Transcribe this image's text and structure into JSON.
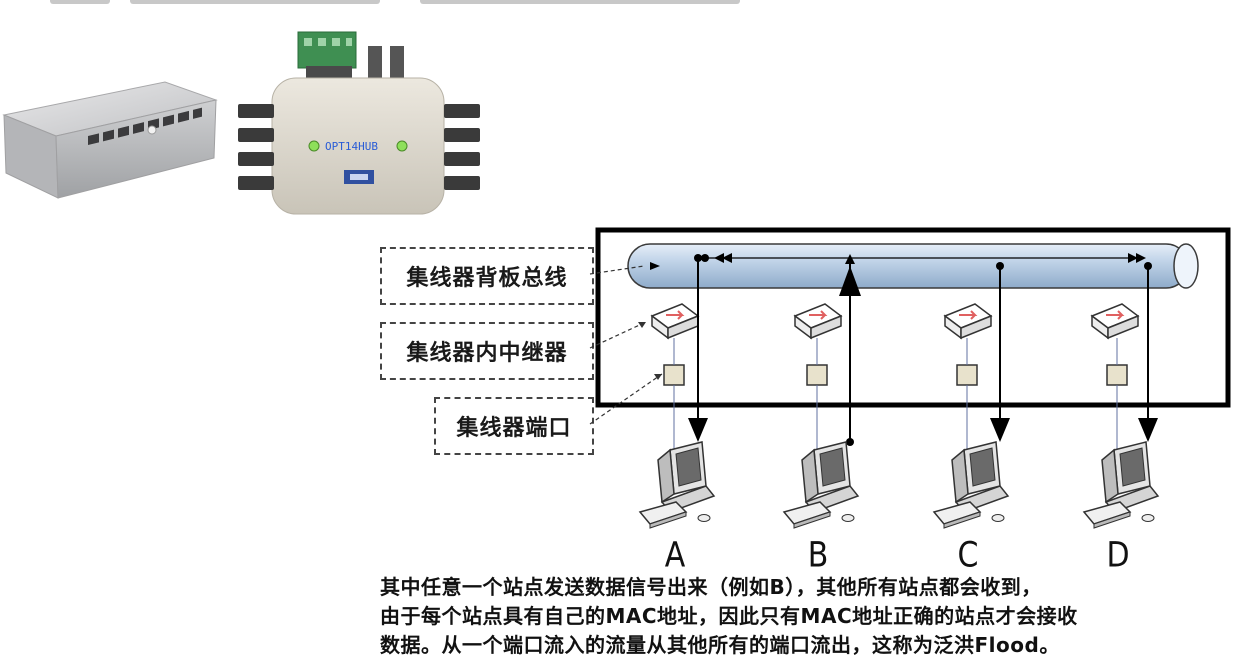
{
  "legend": {
    "backplane_bus": "集线器背板总线",
    "repeater": "集线器内中继器",
    "port": "集线器端口"
  },
  "device": {
    "hub_label": "OPT14HUB"
  },
  "stations": [
    "A",
    "B",
    "C",
    "D"
  ],
  "caption": {
    "line1": "其中任意一个站点发送数据信号出来（例如B），其他所有站点都会收到，",
    "line2": "由于每个站点具有自己的MAC地址，因此只有MAC地址正确的站点才会接收",
    "line3": "数据。从一个端口流入的流量从其他所有的端口流出，这称为泛洪Flood。"
  },
  "colors": {
    "bus_fill": "#b9cfe6",
    "bus_highlight": "#e8f1fb",
    "switch_body": "#ffffff",
    "switch_arrow": "#e06060",
    "port_fill": "#e8e2cc",
    "frame": "#000000"
  }
}
